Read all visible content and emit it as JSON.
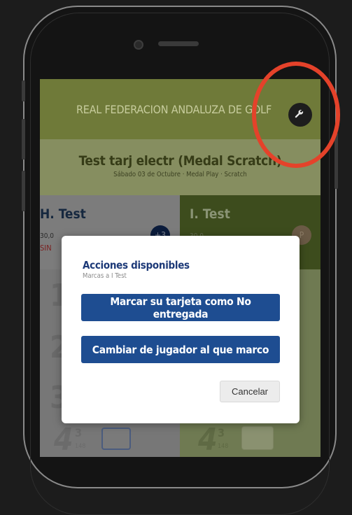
{
  "header": {
    "title": "REAL FEDERACION ANDALUZA DE GOLF",
    "settings_icon": "wrench-icon"
  },
  "event": {
    "title": "Test tarj electr (Medal Scratch)",
    "subtitle": "Sábado 03 de Octubre · Medal Play · Scratch"
  },
  "players": {
    "left": {
      "name": "H. Test",
      "handicap": "30,0",
      "status": "SIN",
      "badge": "+3"
    },
    "right": {
      "name": "I. Test",
      "handicap": "30,0",
      "badge": "P"
    }
  },
  "holes": {
    "left_digits": [
      "1",
      "2",
      "3"
    ],
    "bottom": {
      "par": "4",
      "index": "3",
      "meters": "148"
    }
  },
  "dialog": {
    "title": "Acciones disponibles",
    "subtitle": "Marcas a I Test",
    "action_no_entregada": "Marcar su tarjeta como No entregada",
    "action_cambiar": "Cambiar de jugador al que marco",
    "cancel": "Cancelar"
  },
  "annotation": {
    "color": "#e4422a"
  }
}
